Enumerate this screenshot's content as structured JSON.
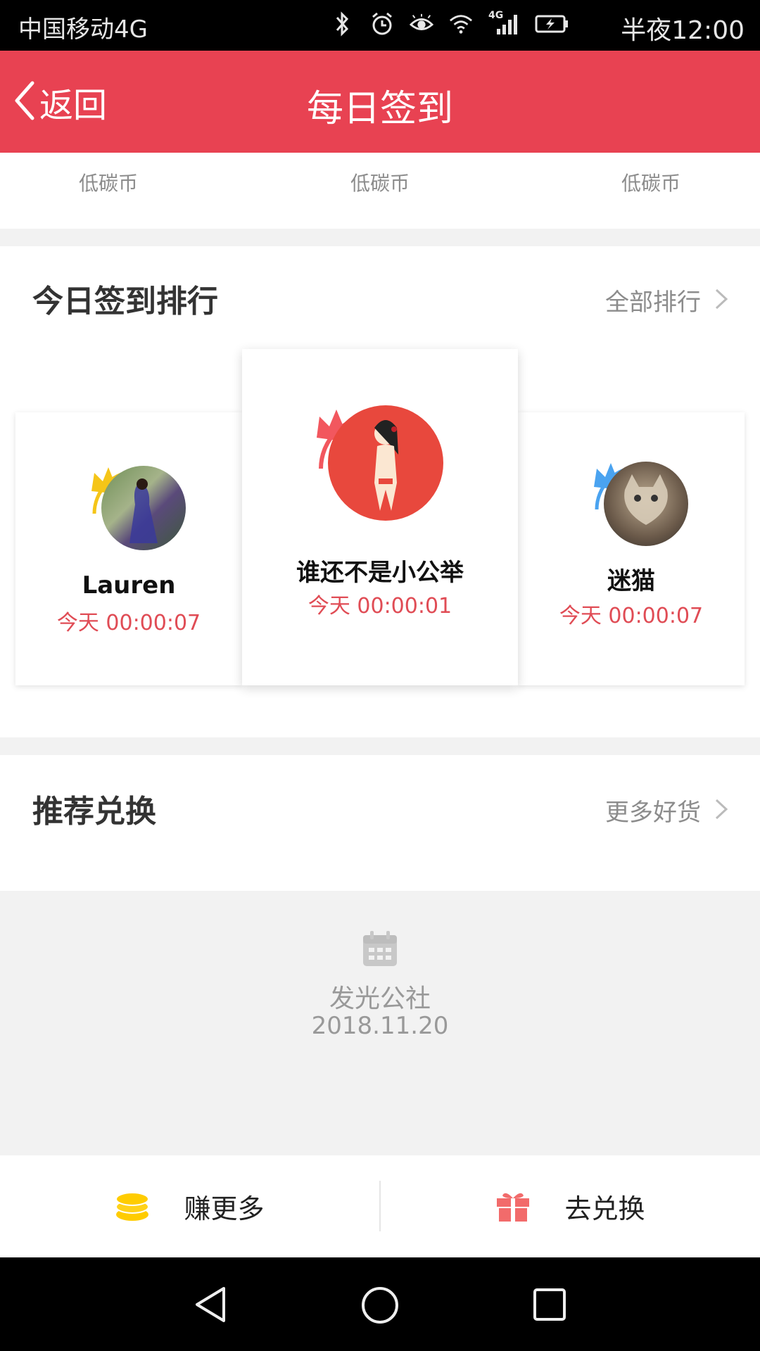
{
  "status_bar": {
    "carrier": "中国移动4G",
    "network_badge": "4G",
    "time": "半夜12:00",
    "icons": [
      "bluetooth-icon",
      "alarm-icon",
      "eye-icon",
      "wifi-icon",
      "signal-icon",
      "battery-charging-icon"
    ]
  },
  "nav": {
    "back_label": "返回",
    "title": "每日签到"
  },
  "coin_labels": [
    "低碳币",
    "低碳币",
    "低碳币"
  ],
  "ranking": {
    "title": "今日签到排行",
    "link_label": "全部排行",
    "users": [
      {
        "name": "Lauren",
        "time": "今天 00:00:07",
        "rank": 2,
        "crown_color": "#f5c518"
      },
      {
        "name": "谁还不是小公举",
        "time": "今天 00:00:01",
        "rank": 1,
        "crown_color": "#f2575e"
      },
      {
        "name": "迷猫",
        "time": "今天 00:00:07",
        "rank": 3,
        "crown_color": "#4aa3f0"
      }
    ]
  },
  "exchange": {
    "title": "推荐兑换",
    "link_label": "更多好货",
    "empty_name": "发光公社",
    "empty_date": "2018.11.20"
  },
  "actions": {
    "earn_label": "赚更多",
    "exchange_label": "去兑换"
  },
  "colors": {
    "accent": "#e84252",
    "time_red": "#e04c55",
    "coin_yellow": "#ffcc00",
    "gift_red": "#f26b6b"
  }
}
